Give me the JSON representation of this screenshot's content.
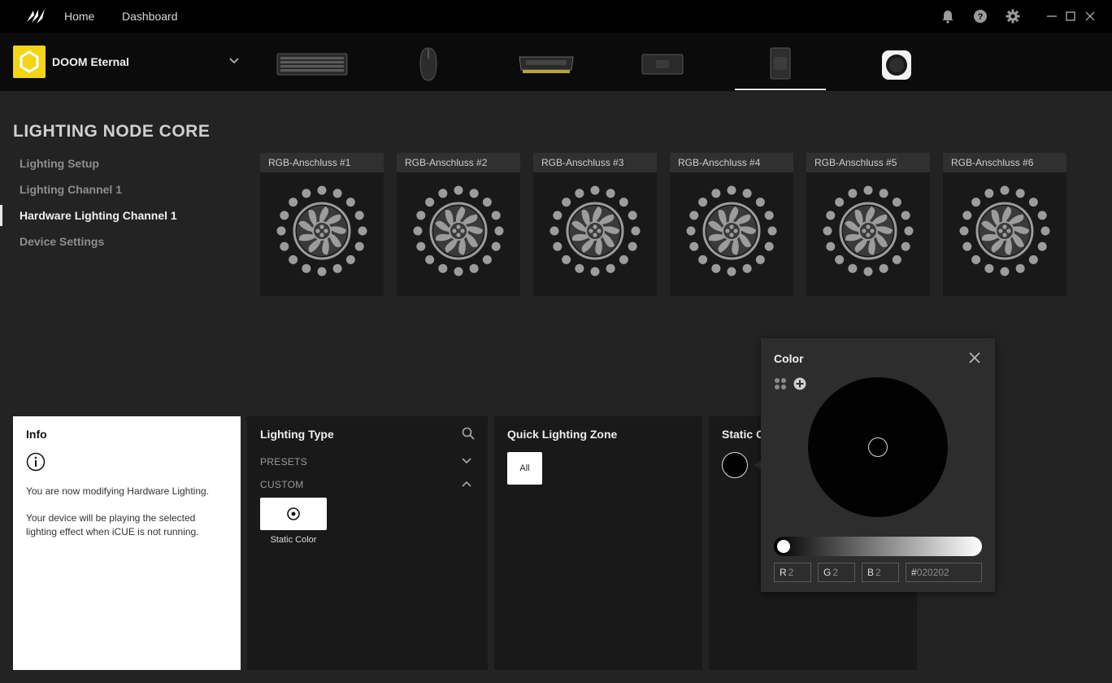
{
  "titlebar": {
    "nav": [
      "Home",
      "Dashboard"
    ],
    "icons": [
      "corsair-logo",
      "bell-icon",
      "help-icon",
      "gear-icon",
      "minimize-icon",
      "maximize-icon",
      "close-icon"
    ]
  },
  "profile": {
    "name": "DOOM Eternal",
    "icon_color": "#f4d416"
  },
  "devices": [
    "keyboard",
    "mouse",
    "memory",
    "lighting-node-pro",
    "lighting-node-core",
    "commander-core"
  ],
  "sidebar": {
    "device_title": "LIGHTING NODE CORE",
    "items": [
      "Lighting Setup",
      "Lighting Channel 1",
      "Hardware Lighting Channel 1",
      "Device Settings"
    ],
    "active_index": 2
  },
  "ports": [
    "RGB-Anschluss #1",
    "RGB-Anschluss #2",
    "RGB-Anschluss #3",
    "RGB-Anschluss #4",
    "RGB-Anschluss #5",
    "RGB-Anschluss #6"
  ],
  "info": {
    "title": "Info",
    "line1": "You are now modifying Hardware Lighting.",
    "line2": "Your device will be playing the selected lighting effect when iCUE is not running."
  },
  "lighting_type": {
    "title": "Lighting Type",
    "presets": "PRESETS",
    "custom": "CUSTOM",
    "tile_label": "Static Color"
  },
  "quick_zone": {
    "title": "Quick Lighting Zone",
    "all": "All"
  },
  "static_panel": {
    "title": "Static C"
  },
  "color_popup": {
    "title": "Color",
    "r_label": "R",
    "r": "2",
    "g_label": "G",
    "g": "2",
    "b_label": "B",
    "b": "2",
    "hex_prefix": "#",
    "hex": "020202",
    "current_color": "#020202"
  },
  "colors": {
    "accent": "#f4d416",
    "background": "#232323",
    "panel": "#191919"
  }
}
